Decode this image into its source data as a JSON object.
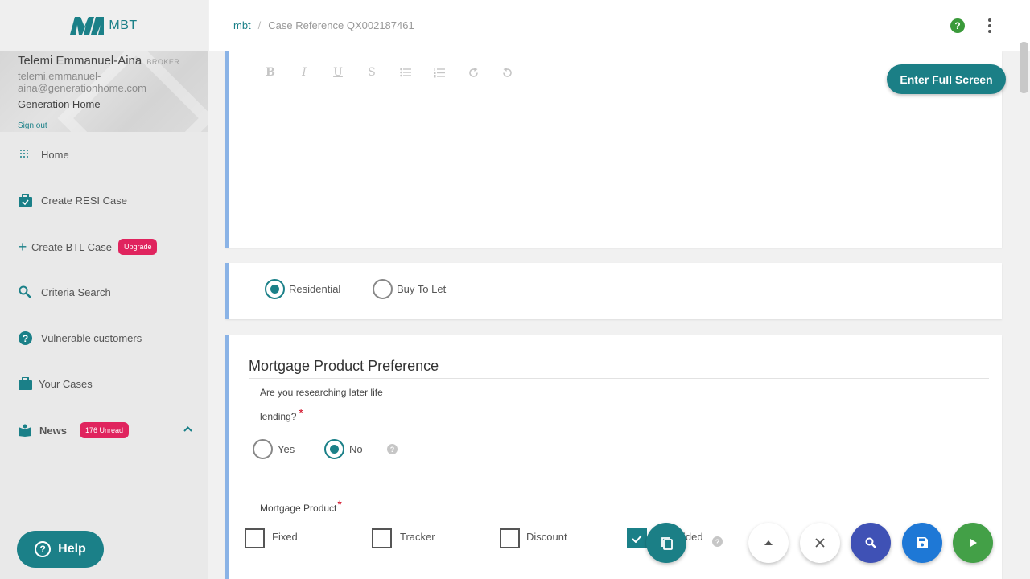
{
  "app": {
    "logo_text": "MBT"
  },
  "profile": {
    "name": "Telemi Emmanuel-Aina",
    "role": "BROKER",
    "email": "telemi.emmanuel-aina@generationhome.com",
    "company": "Generation Home",
    "sign_out": "Sign out"
  },
  "sidebar": {
    "items": [
      {
        "label": "Home",
        "icon": "grid-icon"
      },
      {
        "label": "Create RESI Case",
        "icon": "briefcase-check-icon"
      },
      {
        "label": "Create BTL Case",
        "icon": "plus-icon",
        "badge": "Upgrade"
      },
      {
        "label": "Criteria Search",
        "icon": "search-icon"
      },
      {
        "label": "Vulnerable customers",
        "icon": "help-circle-icon"
      },
      {
        "label": "Your Cases",
        "icon": "briefcase-icon"
      },
      {
        "label": "News",
        "icon": "book-icon",
        "badge": "176 Unread"
      }
    ],
    "help_label": "Help"
  },
  "breadcrumb": {
    "root": "mbt",
    "separator": "/",
    "page": "Case Reference QX002187461"
  },
  "editor": {
    "toolbar": [
      "B",
      "I",
      "U",
      "S",
      "bulleted-list",
      "numbered-list",
      "redo",
      "undo"
    ],
    "fullscreen_label": "Enter Full Screen"
  },
  "case_type": {
    "options": [
      "Residential",
      "Buy To Let"
    ],
    "selected": "Residential"
  },
  "mortgage_preference": {
    "title": "Mortgage Product Preference",
    "later_life_question_line1": "Are you researching later life",
    "later_life_question_line2": "lending?",
    "required_mark": "*",
    "later_life_options": [
      "Yes",
      "No"
    ],
    "later_life_selected": "No",
    "product_label": "Mortgage Product",
    "products": [
      {
        "label": "Fixed",
        "checked": false
      },
      {
        "label": "Tracker",
        "checked": false
      },
      {
        "label": "Discount",
        "checked": false
      },
      {
        "label": "ided",
        "checked": true
      }
    ]
  },
  "colors": {
    "accent": "#1b8088",
    "badge": "#e0245e",
    "card_border": "#8ab3e6",
    "fab_search": "#3f51b5",
    "fab_save": "#1e78d6",
    "fab_next": "#43a047"
  }
}
